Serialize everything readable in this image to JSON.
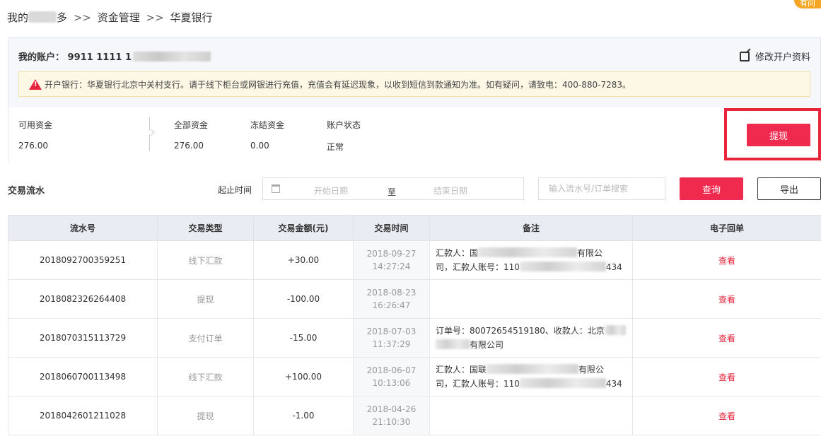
{
  "breadcrumb": {
    "part1": "我的",
    "part1_tail": "多",
    "sep": ">>",
    "part2": "资金管理",
    "part3": "华夏银行"
  },
  "corner_badge": "有问",
  "account": {
    "label": "我的账户：",
    "number": "9911 1111 1",
    "edit_label": "修改开户资料"
  },
  "notice": {
    "text": "开户银行：华夏银行北京中关村支行。请于线下柜台或网银进行充值，充值会有延迟现象，以收到短信到款通知为准。如有疑问，请致电：400-880-7283。"
  },
  "funds": {
    "available_label": "可用资金",
    "available_value": "276.00",
    "total_label": "全部资金",
    "total_value": "276.00",
    "frozen_label": "冻结资金",
    "frozen_value": "0.00",
    "status_label": "账户状态",
    "status_value": "正常"
  },
  "withdraw_label": "提现",
  "toolbar": {
    "title": "交易流水",
    "range_label": "起止时间",
    "start_placeholder": "开始日期",
    "to": "至",
    "end_placeholder": "结束日期",
    "search_placeholder": "输入流水号/订单搜索",
    "query_label": "查询",
    "export_label": "导出"
  },
  "table": {
    "headers": [
      "流水号",
      "交易类型",
      "交易金额(元)",
      "交易时间",
      "备注",
      "电子回单"
    ],
    "rows": [
      {
        "id": "2018092700359251",
        "type": "线下汇款",
        "amount": "+30.00",
        "date": "2018-09-27",
        "time": "14:27:24",
        "note1": "汇款人：国",
        "note1_tail": "有限公",
        "note2": "司，汇款人账号：110",
        "note2_tail": "434",
        "view": "查看"
      },
      {
        "id": "2018082326264408",
        "type": "提现",
        "amount": "-100.00",
        "date": "2018-08-23",
        "time": "16:26:47",
        "note1": "",
        "note1_tail": "",
        "note2": "",
        "note2_tail": "",
        "view": "查看"
      },
      {
        "id": "2018070315113729",
        "type": "支付订单",
        "amount": "-15.00",
        "date": "2018-07-03",
        "time": "11:37:29",
        "note1": "订单号：80072654519180、收款人：北京",
        "note1_tail": "",
        "note2": "",
        "note2_tail": "有限公司",
        "view": "查看"
      },
      {
        "id": "2018060700113498",
        "type": "线下汇款",
        "amount": "+100.00",
        "date": "2018-06-07",
        "time": "10:13:06",
        "note1": "汇款人：国联",
        "note1_tail": "有限公",
        "note2": "司，汇款人账号：110",
        "note2_tail": "434",
        "view": "查看"
      },
      {
        "id": "2018042601211028",
        "type": "提现",
        "amount": "-1.00",
        "date": "2018-04-26",
        "time": "21:10:30",
        "note1": "",
        "note1_tail": "",
        "note2": "",
        "note2_tail": "",
        "view": "查看"
      }
    ]
  }
}
